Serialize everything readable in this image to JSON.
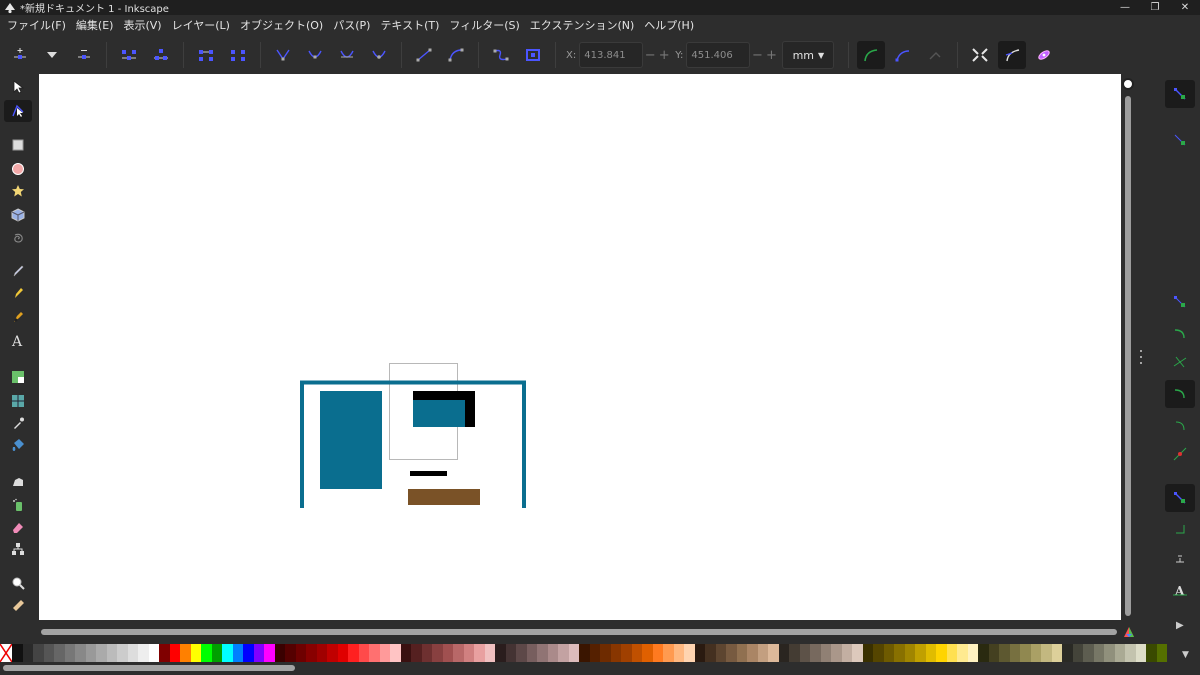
{
  "window": {
    "title": "*新規ドキュメント 1 - Inkscape",
    "controls": [
      "—",
      "❐",
      "✕"
    ]
  },
  "menu": [
    "ファイル(F)",
    "編集(E)",
    "表示(V)",
    "レイヤー(L)",
    "オブジェクト(O)",
    "パス(P)",
    "テキスト(T)",
    "フィルター(S)",
    "エクステンション(N)",
    "ヘルプ(H)"
  ],
  "tool_controls": {
    "x_label": "X:",
    "x_value": "413.841",
    "y_label": "Y:",
    "y_value": "451.406",
    "minus": "−",
    "plus": "+",
    "unit": "mm"
  },
  "tools": [
    "selector-icon",
    "node-tool-icon",
    "rectangle-icon",
    "ellipse-icon",
    "star-icon",
    "3d-box-icon",
    "spiral-icon",
    "pencil-icon",
    "pen-icon",
    "calligraphy-icon",
    "text-icon",
    "gradient-icon",
    "mesh-icon",
    "dropper-icon",
    "paint-bucket-icon",
    "tweak-icon",
    "spray-icon",
    "eraser-icon",
    "connector-icon",
    "zoom-icon",
    "measure-icon"
  ],
  "colors": {
    "teal": "#0a6e8f",
    "black": "#000000",
    "brown": "#7a5227",
    "accent_blue": "#4b55ff",
    "snap_green": "#2aa84a"
  },
  "palette": [
    "#111111",
    "#2a2a2a",
    "#444444",
    "#555555",
    "#666666",
    "#777777",
    "#888888",
    "#999999",
    "#aaaaaa",
    "#bbbbbb",
    "#cccccc",
    "#dddddd",
    "#eeeeee",
    "#ffffff",
    "#800000",
    "#ff0000",
    "#ff8000",
    "#ffff00",
    "#00ff00",
    "#00a000",
    "#00ffff",
    "#0080ff",
    "#0000ff",
    "#8000ff",
    "#ff00ff",
    "#3a0000",
    "#550000",
    "#6e0000",
    "#880000",
    "#a00000",
    "#c00000",
    "#e00000",
    "#ff2020",
    "#ff4a4a",
    "#ff7070",
    "#ff9a9a",
    "#ffc4c4",
    "#3a1010",
    "#552020",
    "#6e3030",
    "#884040",
    "#a05050",
    "#b86868",
    "#d08080",
    "#e8a0a0",
    "#f0c0c0",
    "#2a1d1d",
    "#443333",
    "#5d4848",
    "#775e5e",
    "#907474",
    "#aa8a8a",
    "#c3a2a2",
    "#ddbcbc",
    "#3a1500",
    "#552000",
    "#6e2b00",
    "#883600",
    "#a04000",
    "#c05000",
    "#e06000",
    "#ff7a20",
    "#ff9a50",
    "#ffb880",
    "#ffd4b0",
    "#2a1a10",
    "#443020",
    "#5d4530",
    "#775a40",
    "#907050",
    "#aa8565",
    "#c39f80",
    "#ddb99a",
    "#2a2520",
    "#443c33",
    "#5d5248",
    "#77695e",
    "#908074",
    "#aa978a",
    "#c3afa2",
    "#ddc9bc",
    "#3a3000",
    "#554500",
    "#6e5a00",
    "#887000",
    "#a08500",
    "#c0a000",
    "#e0bc00",
    "#ffd400",
    "#ffe050",
    "#ffea90",
    "#fff2c0",
    "#2a2a10",
    "#444020",
    "#5d5830",
    "#777040",
    "#908850",
    "#aaa065",
    "#c3b880",
    "#ddd09a",
    "#2a2a25",
    "#44443a",
    "#5d5d50",
    "#777766",
    "#90907c",
    "#aaaa94",
    "#c3c3ae",
    "#ddddc8",
    "#3a4a00",
    "#557000"
  ]
}
